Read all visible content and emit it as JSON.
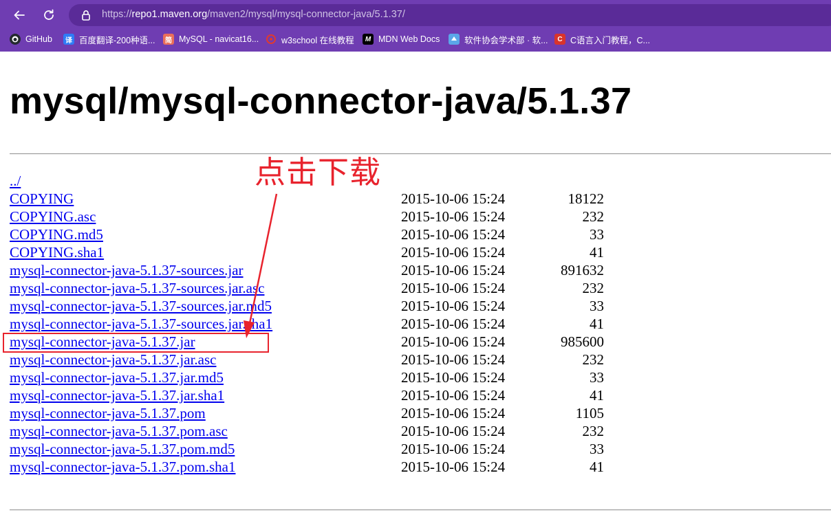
{
  "browser": {
    "url_scheme": "https://",
    "url_host": "repo1.maven.org",
    "url_path": "/maven2/mysql/mysql-connector-java/5.1.37/",
    "bookmarks": [
      {
        "label": "GitHub",
        "icon": "github-icon",
        "color": "#24292f"
      },
      {
        "label": "百度翻译-200种语...",
        "icon": "baidu-translate-icon",
        "color": "#2f7cf6"
      },
      {
        "label": "MySQL - navicat16...",
        "icon": "jianshu-icon",
        "color": "#ea6f5a"
      },
      {
        "label": "w3school 在线教程",
        "icon": "w3school-icon",
        "color": "#c0392b"
      },
      {
        "label": "MDN Web Docs",
        "icon": "mdn-icon",
        "color": "#000000"
      },
      {
        "label": "软件协会学术部 · 软...",
        "icon": "yuque-icon",
        "color": "#5ba6e8"
      },
      {
        "label": "C语言入门教程，C...",
        "icon": "c-tutorial-icon",
        "color": "#d9342b"
      }
    ]
  },
  "page": {
    "title": "mysql/mysql-connector-java/5.1.37",
    "parent_link": "../",
    "files": [
      {
        "name": "COPYING",
        "date": "2015-10-06 15:24",
        "size": "18122"
      },
      {
        "name": "COPYING.asc",
        "date": "2015-10-06 15:24",
        "size": "232"
      },
      {
        "name": "COPYING.md5",
        "date": "2015-10-06 15:24",
        "size": "33"
      },
      {
        "name": "COPYING.sha1",
        "date": "2015-10-06 15:24",
        "size": "41"
      },
      {
        "name": "mysql-connector-java-5.1.37-sources.jar",
        "date": "2015-10-06 15:24",
        "size": "891632"
      },
      {
        "name": "mysql-connector-java-5.1.37-sources.jar.asc",
        "date": "2015-10-06 15:24",
        "size": "232"
      },
      {
        "name": "mysql-connector-java-5.1.37-sources.jar.md5",
        "date": "2015-10-06 15:24",
        "size": "33"
      },
      {
        "name": "mysql-connector-java-5.1.37-sources.jar.sha1",
        "date": "2015-10-06 15:24",
        "size": "41"
      },
      {
        "name": "mysql-connector-java-5.1.37.jar",
        "date": "2015-10-06 15:24",
        "size": "985600"
      },
      {
        "name": "mysql-connector-java-5.1.37.jar.asc",
        "date": "2015-10-06 15:24",
        "size": "232"
      },
      {
        "name": "mysql-connector-java-5.1.37.jar.md5",
        "date": "2015-10-06 15:24",
        "size": "33"
      },
      {
        "name": "mysql-connector-java-5.1.37.jar.sha1",
        "date": "2015-10-06 15:24",
        "size": "41"
      },
      {
        "name": "mysql-connector-java-5.1.37.pom",
        "date": "2015-10-06 15:24",
        "size": "1105"
      },
      {
        "name": "mysql-connector-java-5.1.37.pom.asc",
        "date": "2015-10-06 15:24",
        "size": "232"
      },
      {
        "name": "mysql-connector-java-5.1.37.pom.md5",
        "date": "2015-10-06 15:24",
        "size": "33"
      },
      {
        "name": "mysql-connector-java-5.1.37.pom.sha1",
        "date": "2015-10-06 15:24",
        "size": "41"
      }
    ]
  },
  "annotation": {
    "text": "点击下载",
    "color": "#e8232d"
  },
  "colors": {
    "chrome": "#6f3db2",
    "link": "#0000ee"
  }
}
